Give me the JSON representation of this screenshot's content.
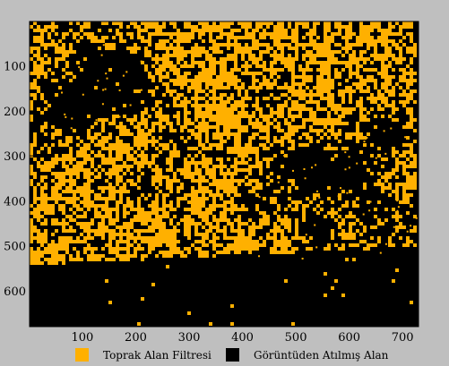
{
  "chart_data": {
    "type": "heatmap",
    "title": "",
    "xlabel": "",
    "ylabel": "",
    "xlim": [
      1,
      730
    ],
    "ylim": [
      680,
      1
    ],
    "x_ticks": [
      "100",
      "200",
      "300",
      "400",
      "500",
      "600",
      "700"
    ],
    "y_ticks": [
      "100",
      "200",
      "300",
      "400",
      "500",
      "600"
    ],
    "grid": false,
    "classes": [
      {
        "name": "Toprak Alan Filtresi",
        "color": "#ffb000"
      },
      {
        "name": "Görüntüden Atılmış Alan",
        "color": "#000000"
      }
    ],
    "legend_position": "bottom"
  }
}
